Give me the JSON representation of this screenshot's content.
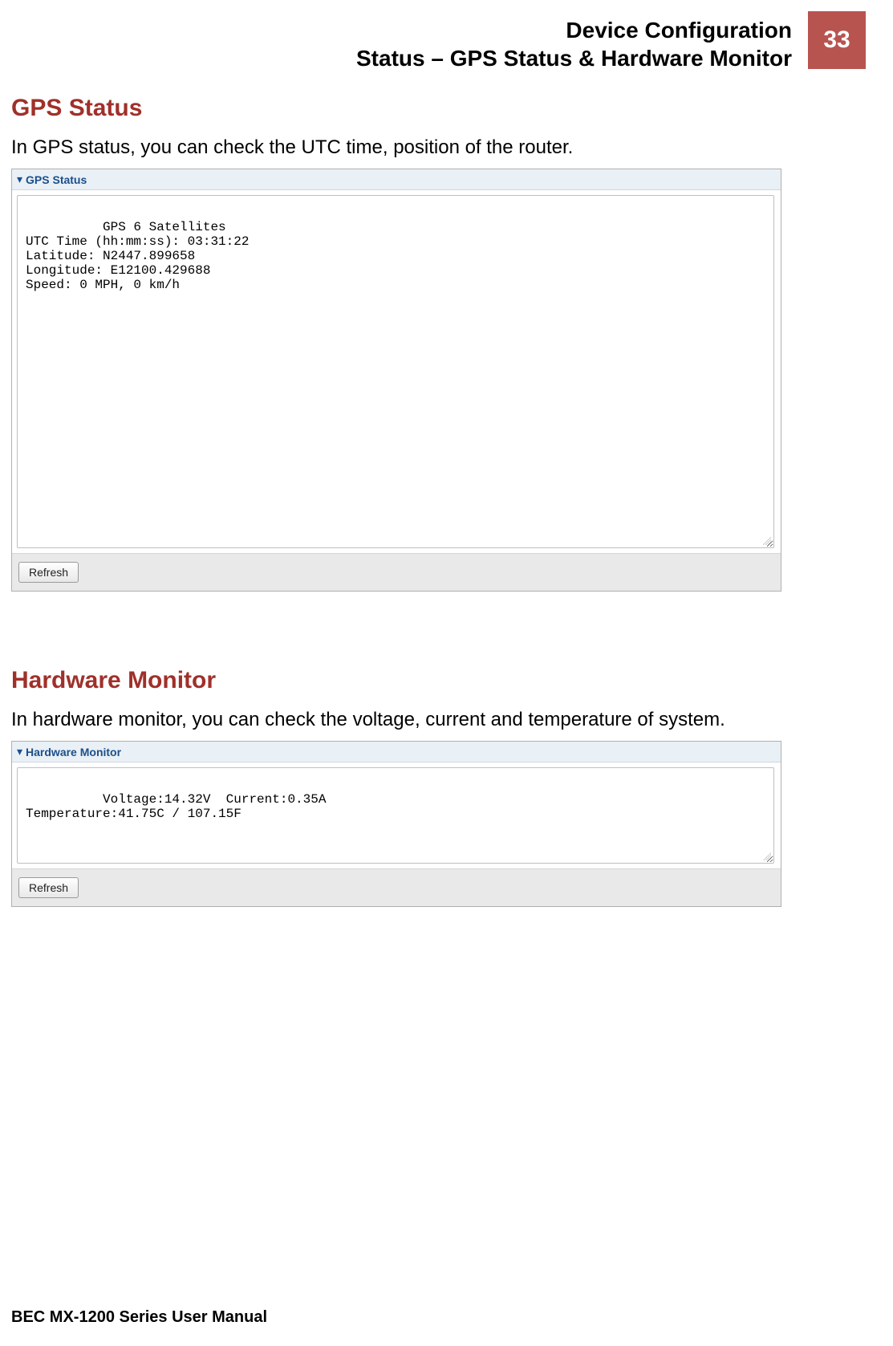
{
  "header": {
    "line1": "Device Configuration",
    "line2": "Status – GPS Status & Hardware Monitor",
    "page_number": "33"
  },
  "sections": {
    "gps": {
      "title": "GPS Status",
      "description": "In GPS status, you can check the UTC time, position of the router.",
      "panel_title": "GPS Status",
      "body_text": "GPS 6 Satellites\nUTC Time (hh:mm:ss): 03:31:22\nLatitude: N2447.899658\nLongitude: E12100.429688\nSpeed: 0 MPH, 0 km/h",
      "refresh_label": "Refresh"
    },
    "hw": {
      "title": "Hardware Monitor",
      "description": "In hardware monitor, you can check the voltage, current and temperature of system.",
      "panel_title": "Hardware Monitor",
      "body_text": "Voltage:14.32V  Current:0.35A\nTemperature:41.75C / 107.15F",
      "refresh_label": "Refresh"
    }
  },
  "footer": {
    "text": "BEC MX-1200 Series User Manual"
  }
}
